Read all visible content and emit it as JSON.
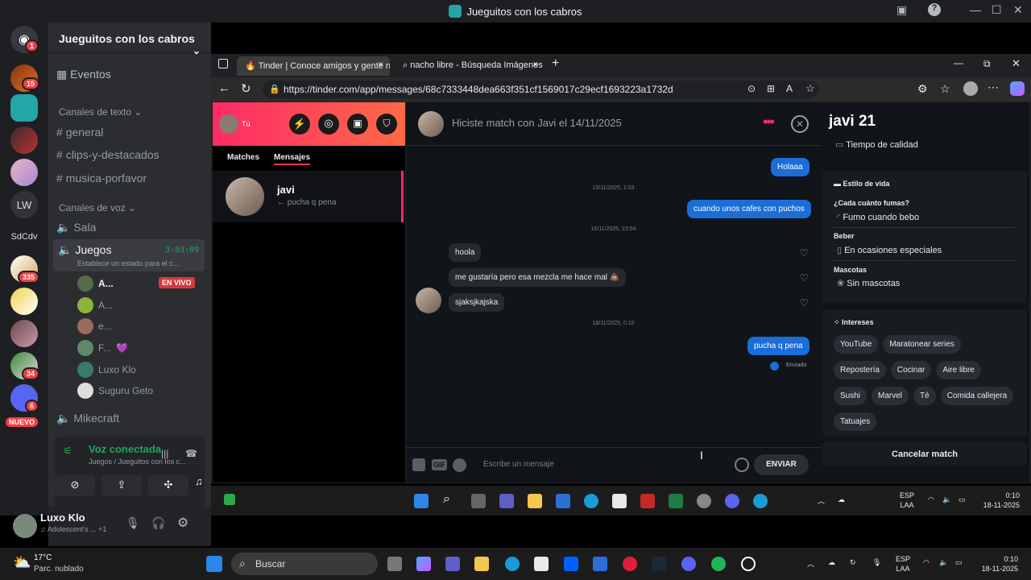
{
  "window": {
    "title": "Jueguitos con los cabros"
  },
  "rail": {
    "badges": [
      "1",
      "15",
      "335",
      "34",
      "6"
    ],
    "lw_label": "LW",
    "sdcdv_label": "SdCdv",
    "nuevo_label": "NUEVO"
  },
  "server": {
    "name": "Jueguitos con los cabros",
    "events": "Eventos",
    "text_category": "Canales de texto",
    "text_channels": [
      "general",
      "clips-y-destacados",
      "musica-porfavor"
    ],
    "voice_category": "Canales de voz",
    "voice_channels": [
      "Sala",
      "Juegos",
      "Mikecraft"
    ],
    "juegos_timer": "3:03:09",
    "juegos_status": "Establece un estado para el c...",
    "voice_users": [
      "A...",
      "A...",
      "e...",
      "F...",
      "Luxo Klo",
      "Suguru Geto"
    ],
    "live_badge": "EN VIVO"
  },
  "voice_connected": {
    "title": "Voz conectada",
    "sub": "Juegos / Jueguitos con los c..."
  },
  "user": {
    "name": "Luxo Klo",
    "status": "Adolescent's ...",
    "extra": "+1"
  },
  "browser": {
    "tabs": [
      {
        "label": "Tinder | Conoce amigos y gente n"
      },
      {
        "label": "nacho libre - Búsqueda Imágenes"
      }
    ],
    "url": "https://tinder.com/app/messages/68c7333448dea663f351cf1569017c29ecf1693223a1732d"
  },
  "tinder": {
    "me_label": "Tú",
    "tabs": [
      "Matches",
      "Mensajes"
    ],
    "conversation": {
      "name": "javi",
      "preview": "← pucha q pena"
    },
    "chat_header": "Hiciste match con Javi el 14/11/2025",
    "messages": {
      "m1": "Holaaa",
      "t1": "15/11/2025, 1:03",
      "m2": "cuando unos cafes con puchos",
      "t2": "16/11/2025, 23:54",
      "m3": "hoola",
      "m4": "me gustaría pero esa mezcla me hace mal 💩",
      "m5": "sjaksjkajska",
      "t3": "18/11/2025, 0:10",
      "m6": "pucha q pena",
      "sent": "Enviado"
    },
    "input_placeholder": "Escribe un mensaje",
    "send_label": "ENVIAR",
    "gif_label": "GIF"
  },
  "profile": {
    "name_age": "javi 21",
    "love_language": "Tiempo de calidad",
    "lifestyle_title": "Estilo de vida",
    "smoke_q": "¿Cada cuánto fumas?",
    "smoke_a": "Fumo cuando bebo",
    "drink_q": "Beber",
    "drink_a": "En ocasiones especiales",
    "pets_q": "Mascotas",
    "pets_a": "Sin mascotas",
    "interests_title": "Intereses",
    "interests": [
      "YouTube",
      "Maratonear series",
      "Repostería",
      "Cocinar",
      "Aire libre",
      "Sushi",
      "Marvel",
      "Té",
      "Comida callejera",
      "Tatuajes"
    ],
    "cancel": "Cancelar match"
  },
  "taskbar_inner": {
    "lang": "ESP",
    "lang2": "LAA",
    "time": "0:10",
    "date": "18-11-2025"
  },
  "taskbar": {
    "weather_temp": "17°C",
    "weather_desc": "Parc. nublado",
    "search": "Buscar",
    "lang": "ESP",
    "lang2": "LAA",
    "time": "0:10",
    "date": "18-11-2025"
  }
}
